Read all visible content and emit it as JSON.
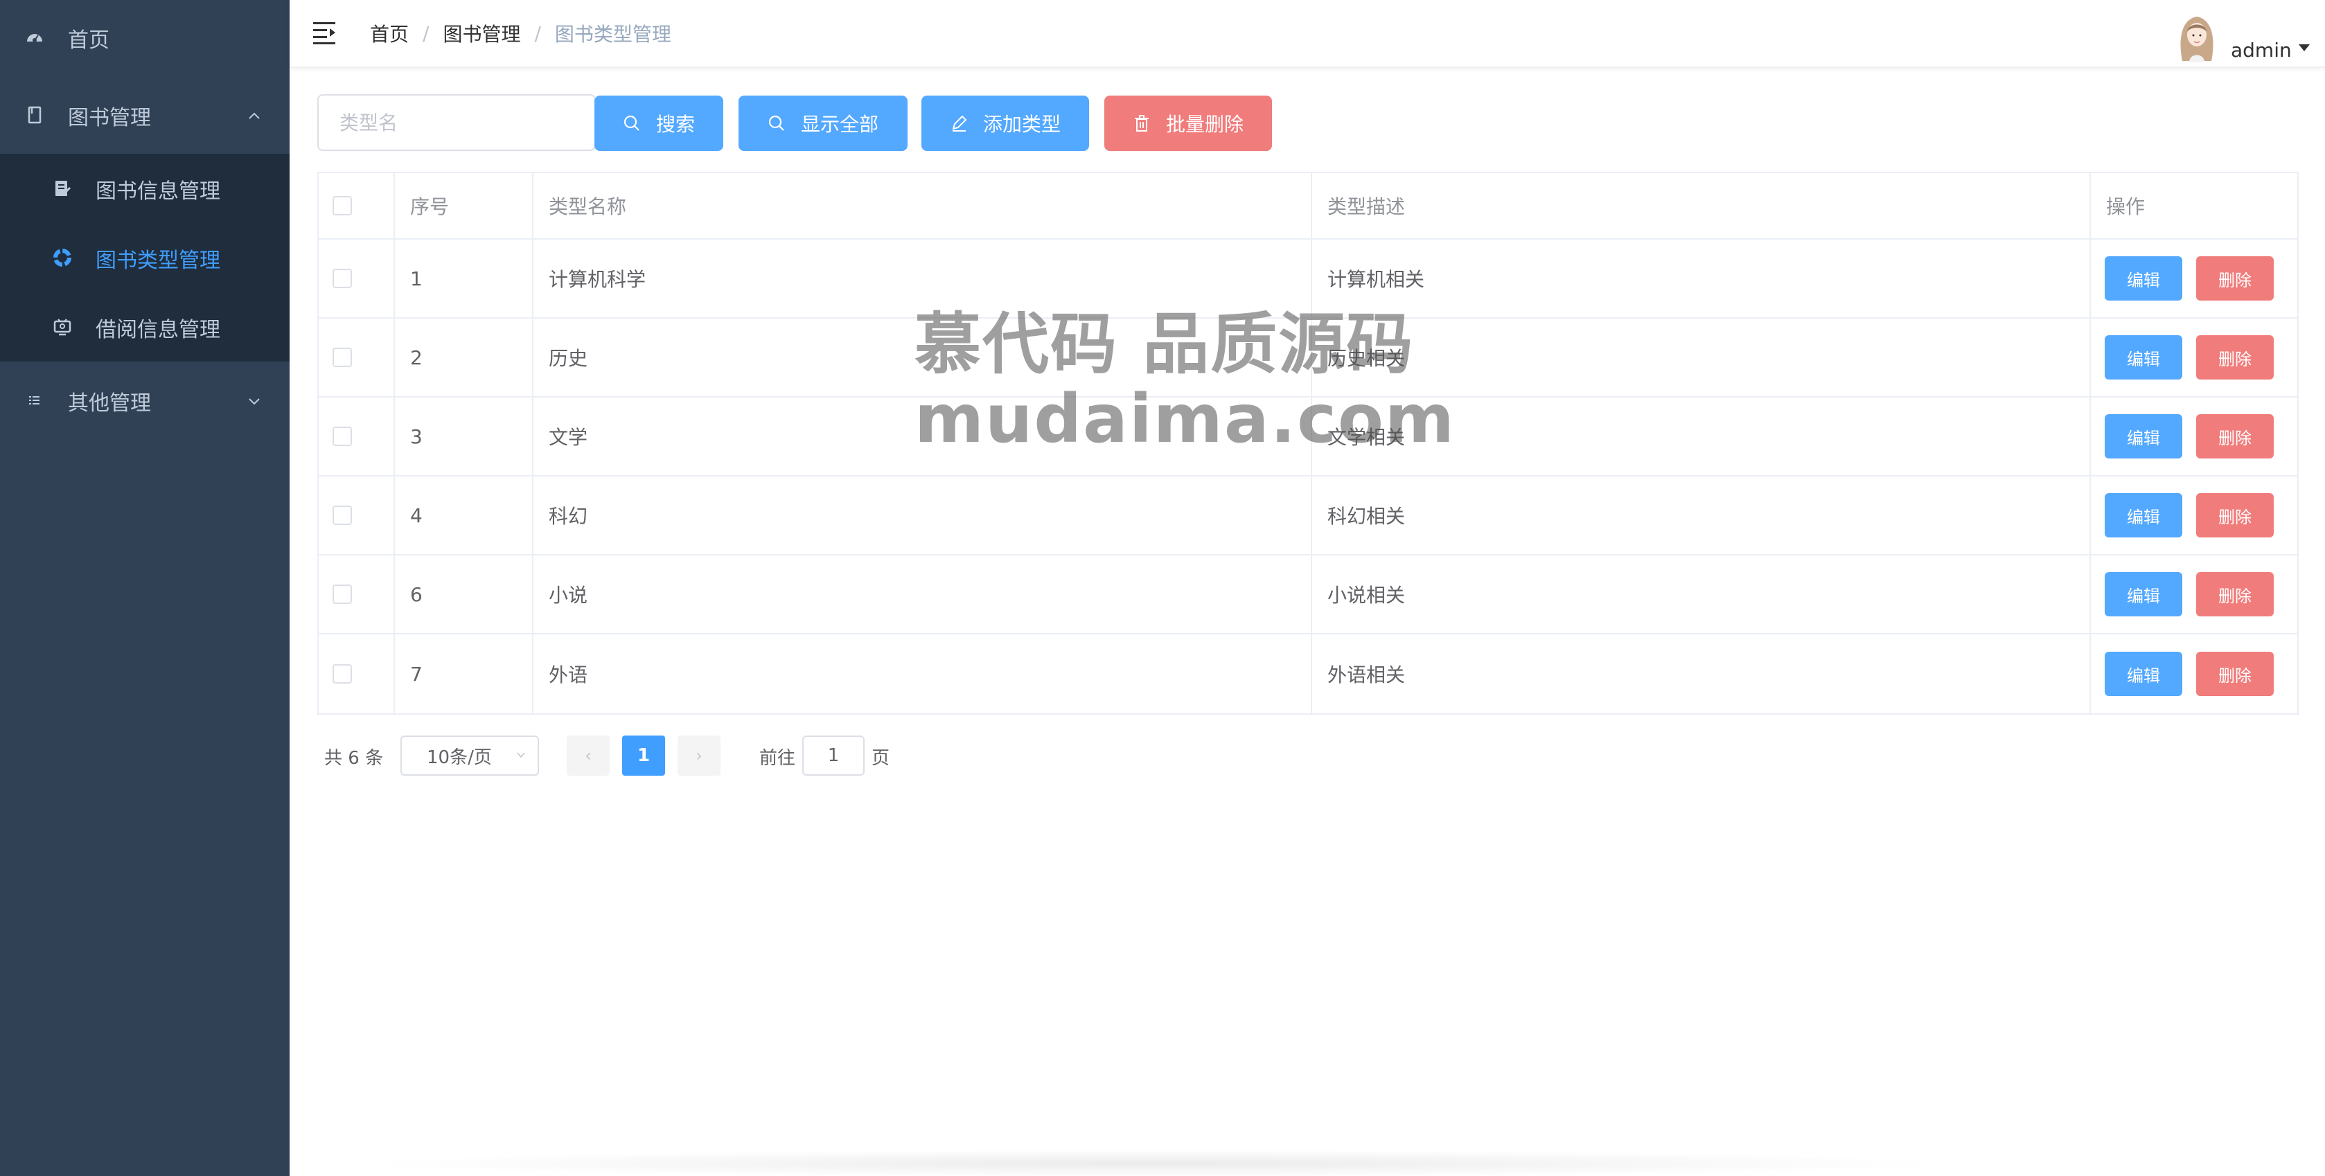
{
  "sidebar": {
    "items": [
      {
        "label": "首页",
        "icon": "dashboard-icon"
      },
      {
        "label": "图书管理",
        "icon": "document-icon",
        "expanded": true
      },
      {
        "label": "图书信息管理",
        "icon": "edit-document-icon"
      },
      {
        "label": "图书类型管理",
        "icon": "ring-icon",
        "active": true
      },
      {
        "label": "借阅信息管理",
        "icon": "monitor-icon"
      },
      {
        "label": "其他管理",
        "icon": "list-icon"
      }
    ],
    "active_color": "#409eff"
  },
  "header": {
    "breadcrumb": [
      "首页",
      "图书管理",
      "图书类型管理"
    ],
    "separator": "/",
    "user": "admin"
  },
  "toolbar": {
    "search_placeholder": "类型名",
    "search_value": "",
    "search_label": "搜索",
    "show_all_label": "显示全部",
    "add_label": "添加类型",
    "batch_delete_label": "批量删除"
  },
  "table": {
    "columns": [
      "序号",
      "类型名称",
      "类型描述",
      "操作"
    ],
    "rows": [
      {
        "id": "1",
        "name": "计算机科学",
        "desc": "计算机相关"
      },
      {
        "id": "2",
        "name": "历史",
        "desc": "历史相关"
      },
      {
        "id": "3",
        "name": "文学",
        "desc": "文学相关"
      },
      {
        "id": "4",
        "name": "科幻",
        "desc": "科幻相关"
      },
      {
        "id": "6",
        "name": "小说",
        "desc": "小说相关"
      },
      {
        "id": "7",
        "name": "外语",
        "desc": "外语相关"
      }
    ],
    "edit_label": "编辑",
    "delete_label": "删除"
  },
  "pagination": {
    "total_text": "共 6 条",
    "page_size": "10条/页",
    "current_page": "1",
    "goto_prefix": "前往",
    "goto_value": "1",
    "goto_suffix": "页",
    "prev_glyph": "‹",
    "next_glyph": "›"
  },
  "watermark": {
    "line1": "慕代码 品质源码",
    "line2": "mudaima.com"
  },
  "colors": {
    "sidebar_bg": "#304156",
    "submenu_bg": "#1f2d3d",
    "primary": "#53a8ff",
    "danger": "#f07c7b"
  }
}
